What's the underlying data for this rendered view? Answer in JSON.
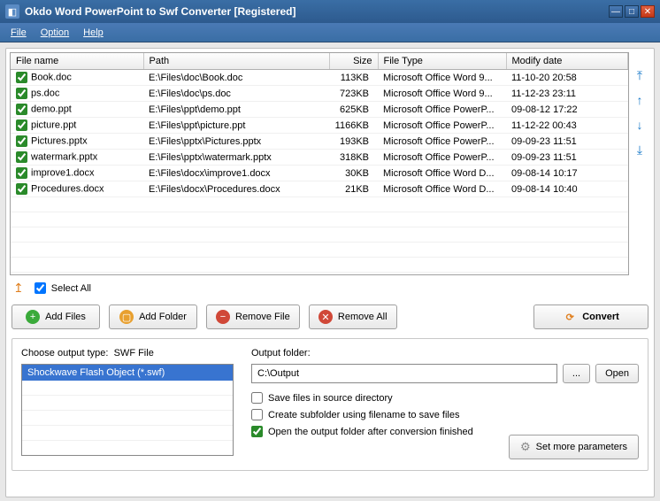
{
  "window": {
    "title": "Okdo Word PowerPoint to Swf Converter [Registered]"
  },
  "menu": {
    "file": "File",
    "option": "Option",
    "help": "Help"
  },
  "columns": {
    "name": "File name",
    "path": "Path",
    "size": "Size",
    "type": "File Type",
    "date": "Modify date"
  },
  "files": [
    {
      "name": "Book.doc",
      "path": "E:\\Files\\doc\\Book.doc",
      "size": "113KB",
      "type": "Microsoft Office Word 9...",
      "date": "11-10-20 20:58"
    },
    {
      "name": "ps.doc",
      "path": "E:\\Files\\doc\\ps.doc",
      "size": "723KB",
      "type": "Microsoft Office Word 9...",
      "date": "11-12-23 23:11"
    },
    {
      "name": "demo.ppt",
      "path": "E:\\Files\\ppt\\demo.ppt",
      "size": "625KB",
      "type": "Microsoft Office PowerP...",
      "date": "09-08-12 17:22"
    },
    {
      "name": "picture.ppt",
      "path": "E:\\Files\\ppt\\picture.ppt",
      "size": "1166KB",
      "type": "Microsoft Office PowerP...",
      "date": "11-12-22 00:43"
    },
    {
      "name": "Pictures.pptx",
      "path": "E:\\Files\\pptx\\Pictures.pptx",
      "size": "193KB",
      "type": "Microsoft Office PowerP...",
      "date": "09-09-23 11:51"
    },
    {
      "name": "watermark.pptx",
      "path": "E:\\Files\\pptx\\watermark.pptx",
      "size": "318KB",
      "type": "Microsoft Office PowerP...",
      "date": "09-09-23 11:51"
    },
    {
      "name": "improve1.docx",
      "path": "E:\\Files\\docx\\improve1.docx",
      "size": "30KB",
      "type": "Microsoft Office Word D...",
      "date": "09-08-14 10:17"
    },
    {
      "name": "Procedures.docx",
      "path": "E:\\Files\\docx\\Procedures.docx",
      "size": "21KB",
      "type": "Microsoft Office Word D...",
      "date": "09-08-14 10:40"
    }
  ],
  "selectall": "Select All",
  "buttons": {
    "addfiles": "Add Files",
    "addfolder": "Add Folder",
    "removefile": "Remove File",
    "removeall": "Remove All",
    "convert": "Convert"
  },
  "output": {
    "type_label": "Choose output type:",
    "type_value": "SWF File",
    "selected_format": "Shockwave Flash Object (*.swf)",
    "folder_label": "Output folder:",
    "folder_value": "C:\\Output",
    "browse": "...",
    "open": "Open",
    "save_source": "Save files in source directory",
    "create_sub": "Create subfolder using filename to save files",
    "open_after": "Open the output folder after conversion finished",
    "more_params": "Set more parameters"
  }
}
